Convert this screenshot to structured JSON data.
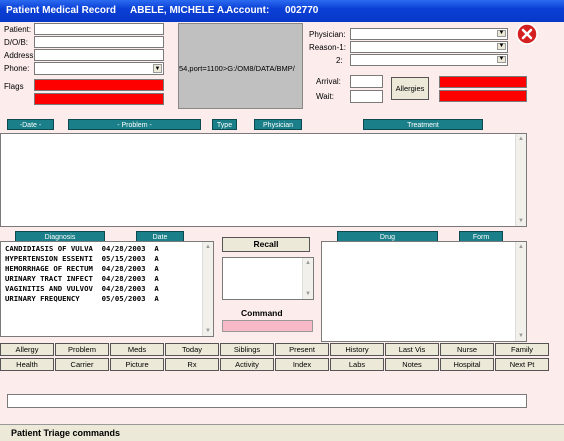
{
  "titlebar": {
    "title": "Patient Medical Record",
    "patient_name": "ABELE, MICHELE A.",
    "account_label": "Account:",
    "account_number": "002770"
  },
  "patient_fields": {
    "patient_label": "Patient:",
    "dob_label": "D/O/B:",
    "address_label": "Address:",
    "phone_label": "Phone:",
    "flags_label": "Flags"
  },
  "image_path": "54,port=1100>G:/OM8/DATA/BMP/",
  "visit_fields": {
    "physician_label": "Physician:",
    "reason1_label": "Reason-1:",
    "reason2_label": "2:",
    "arrival_label": "Arrival:",
    "wait_label": "Wait:",
    "allergies_button": "Allergies"
  },
  "grid_headers": {
    "date": "-Date -",
    "problem": "- Problem -",
    "type": "Type",
    "physician": "Physician",
    "treatment": "Treatment"
  },
  "diagnosis": {
    "header_diagnosis": "Diagnosis",
    "header_date": "Date",
    "rows": [
      "CANDIDIASIS OF VULVA  04/28/2003  A",
      "HYPERTENSION ESSENTI  05/15/2003  A",
      "HEMORRHAGE OF RECTUM  04/28/2003  A",
      "URINARY TRACT INFECT  04/28/2003  A",
      "VAGINITIS AND VULVOV  04/28/2003  A",
      "URINARY FREQUENCY     05/05/2003  A"
    ]
  },
  "recall_button": "Recall",
  "command_label": "Command",
  "drug_headers": {
    "drug": "Drug",
    "form": "Form"
  },
  "nav_row1": [
    "Allergy",
    "Problem",
    "Meds",
    "Today",
    "Siblings",
    "Present",
    "History",
    "Last Vis",
    "Nurse",
    "Family"
  ],
  "nav_row2": [
    "Health",
    "Carrier",
    "Picture",
    "Rx",
    "Activity",
    "Index",
    "Labs",
    "Notes",
    "Hospital",
    "Next Pt"
  ],
  "status_text": "Patient Triage  commands",
  "colors": {
    "titlebar": "#0a3fd6",
    "header_teal": "#1a7f88",
    "flag_red": "#ff0000",
    "command_pink": "#f7b8c8",
    "window_bg": "#fcecec"
  }
}
